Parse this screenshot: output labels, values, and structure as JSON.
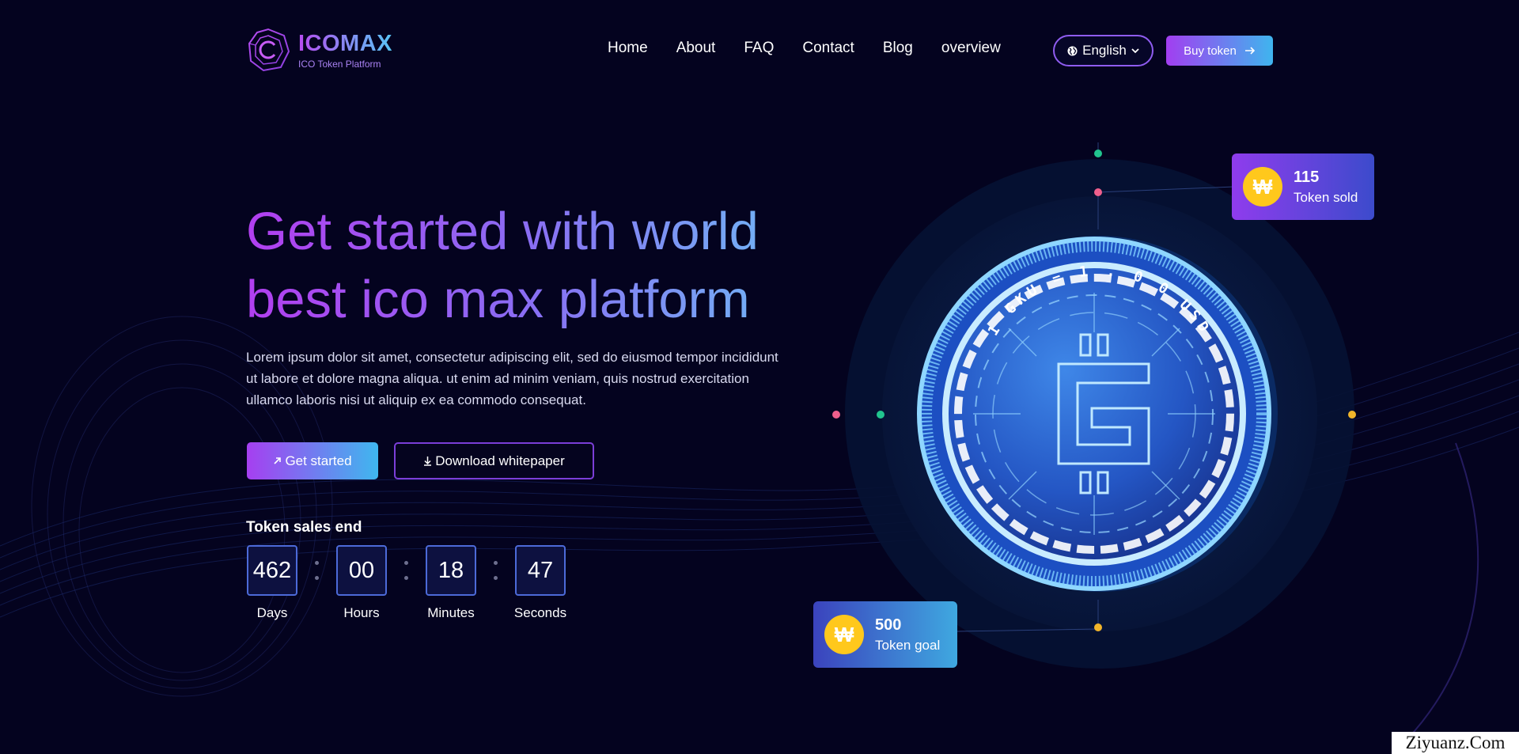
{
  "brand": {
    "name": "ICOMAX",
    "tagline": "ICO Token Platform",
    "gradient": [
      "#b74cf0",
      "#58c5f5"
    ]
  },
  "nav": {
    "items": [
      {
        "label": "Home"
      },
      {
        "label": "About"
      },
      {
        "label": "FAQ"
      },
      {
        "label": "Contact"
      },
      {
        "label": "Blog"
      },
      {
        "label": "overview"
      }
    ]
  },
  "language": {
    "selected": "English",
    "icon": "globe-icon"
  },
  "header": {
    "buy_label": "Buy token",
    "buy_icon": "arrow-right-icon"
  },
  "hero": {
    "title_line1": "Get started with world",
    "title_line2": "best ico max platform",
    "description": "Lorem ipsum dolor sit amet, consectetur adipiscing elit, sed do eiusmod tempor incididunt ut labore et dolore magna aliqua. ut enim ad minim veniam, quis nostrud exercitation ullamco laboris nisi ut aliquip ex ea commodo consequat.",
    "primary_label": "Get started",
    "secondary_label": "Download whitepaper"
  },
  "sales": {
    "label": "Token sales end",
    "countdown": [
      {
        "value": "462",
        "label": "Days"
      },
      {
        "value": "00",
        "label": "Hours"
      },
      {
        "value": "18",
        "label": "Minutes"
      },
      {
        "value": "47",
        "label": "Seconds"
      }
    ]
  },
  "coin": {
    "ring_text": "1 GKU = 1 . 0 0 USD",
    "symbol": "G"
  },
  "stats": {
    "sold": {
      "value": "115",
      "label": "Token sold",
      "icon": "won-coin-icon"
    },
    "goal": {
      "value": "500",
      "label": "Token goal",
      "icon": "won-coin-icon"
    }
  },
  "colors": {
    "background": "#04031f",
    "accent_purple": "#a23ef0",
    "accent_blue": "#3fb5ee",
    "coin_gold": "#ffc81c"
  },
  "watermark": "Ziyuanz.Com"
}
